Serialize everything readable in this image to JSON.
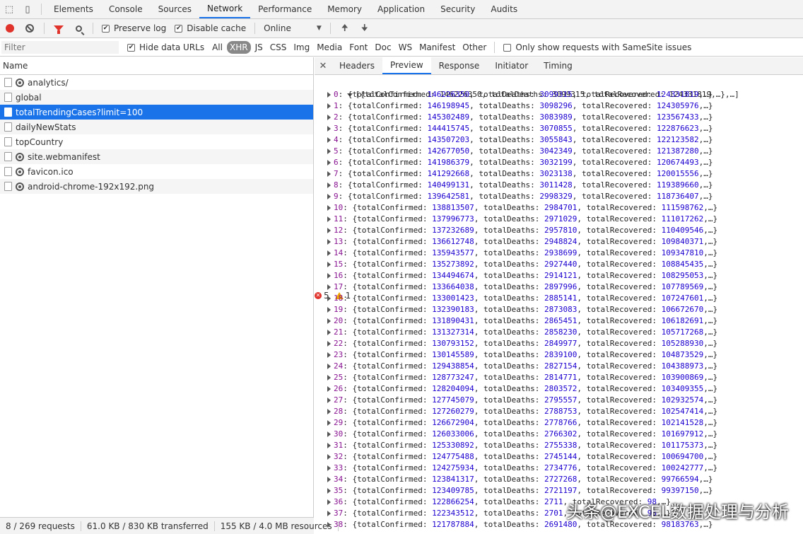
{
  "tabs": [
    "Elements",
    "Console",
    "Sources",
    "Network",
    "Performance",
    "Memory",
    "Application",
    "Security",
    "Audits"
  ],
  "active_tab": "Network",
  "errors_count": "5",
  "warnings_count": "1",
  "toolbar": {
    "preserve_log": "Preserve log",
    "disable_cache": "Disable cache",
    "throttle": "Online"
  },
  "filter": {
    "placeholder": "Filter",
    "hide_data_urls": "Hide data URLs",
    "types": [
      "All",
      "XHR",
      "JS",
      "CSS",
      "Img",
      "Media",
      "Font",
      "Doc",
      "WS",
      "Manifest",
      "Other"
    ],
    "active_type": "XHR",
    "samesite": "Only show requests with SameSite issues"
  },
  "list": {
    "header": "Name",
    "rows": [
      {
        "name": "analytics/",
        "gear": true
      },
      {
        "name": "global",
        "gear": false
      },
      {
        "name": "totalTrendingCases?limit=100",
        "gear": false,
        "selected": true
      },
      {
        "name": "dailyNewStats",
        "gear": false
      },
      {
        "name": "topCountry",
        "gear": false
      },
      {
        "name": "site.webmanifest",
        "gear": true
      },
      {
        "name": "favicon.ico",
        "gear": true
      },
      {
        "name": "android-chrome-192x192.png",
        "gear": true
      }
    ]
  },
  "status": {
    "requests": "8 / 269 requests",
    "transferred": "61.0 KB / 830 KB transferred",
    "resources": "155 KB / 4.0 MB resources"
  },
  "detail_tabs": [
    "Headers",
    "Preview",
    "Response",
    "Initiator",
    "Timing"
  ],
  "active_detail_tab": "Preview",
  "preview": {
    "root": "[{totalConfirmed: 146226350, totalDeaths: 3099315, totalRecovered: 124331819,…},…]",
    "items": [
      {
        "i": "0",
        "c": "146226350",
        "d": "3099315",
        "r": "124331819"
      },
      {
        "i": "1",
        "c": "146198945",
        "d": "3098296",
        "r": "124305976"
      },
      {
        "i": "2",
        "c": "145302489",
        "d": "3083989",
        "r": "123567433"
      },
      {
        "i": "3",
        "c": "144415745",
        "d": "3070855",
        "r": "122876623"
      },
      {
        "i": "4",
        "c": "143507203",
        "d": "3055843",
        "r": "122123582"
      },
      {
        "i": "5",
        "c": "142677050",
        "d": "3042349",
        "r": "121387280"
      },
      {
        "i": "6",
        "c": "141986379",
        "d": "3032199",
        "r": "120674493"
      },
      {
        "i": "7",
        "c": "141292668",
        "d": "3023138",
        "r": "120015556"
      },
      {
        "i": "8",
        "c": "140499131",
        "d": "3011428",
        "r": "119389660"
      },
      {
        "i": "9",
        "c": "139642581",
        "d": "2998329",
        "r": "118736407"
      },
      {
        "i": "10",
        "c": "138813507",
        "d": "2984701",
        "r": "111598762"
      },
      {
        "i": "11",
        "c": "137996773",
        "d": "2971029",
        "r": "111017262"
      },
      {
        "i": "12",
        "c": "137232689",
        "d": "2957810",
        "r": "110409546"
      },
      {
        "i": "13",
        "c": "136612748",
        "d": "2948824",
        "r": "109840371"
      },
      {
        "i": "14",
        "c": "135943577",
        "d": "2938699",
        "r": "109347810"
      },
      {
        "i": "15",
        "c": "135273892",
        "d": "2927440",
        "r": "108845435"
      },
      {
        "i": "16",
        "c": "134494674",
        "d": "2914121",
        "r": "108295053"
      },
      {
        "i": "17",
        "c": "133664038",
        "d": "2897996",
        "r": "107789569"
      },
      {
        "i": "18",
        "c": "133001423",
        "d": "2885141",
        "r": "107247601"
      },
      {
        "i": "19",
        "c": "132390183",
        "d": "2873083",
        "r": "106672670"
      },
      {
        "i": "20",
        "c": "131890431",
        "d": "2865451",
        "r": "106182691"
      },
      {
        "i": "21",
        "c": "131327314",
        "d": "2858230",
        "r": "105717268"
      },
      {
        "i": "22",
        "c": "130793152",
        "d": "2849977",
        "r": "105288930"
      },
      {
        "i": "23",
        "c": "130145589",
        "d": "2839100",
        "r": "104873529"
      },
      {
        "i": "24",
        "c": "129438854",
        "d": "2827154",
        "r": "104388973"
      },
      {
        "i": "25",
        "c": "128773247",
        "d": "2814771",
        "r": "103900869"
      },
      {
        "i": "26",
        "c": "128204094",
        "d": "2803572",
        "r": "103409355"
      },
      {
        "i": "27",
        "c": "127745079",
        "d": "2795557",
        "r": "102932574"
      },
      {
        "i": "28",
        "c": "127260279",
        "d": "2788753",
        "r": "102547414"
      },
      {
        "i": "29",
        "c": "126672904",
        "d": "2778766",
        "r": "102141528"
      },
      {
        "i": "30",
        "c": "126033006",
        "d": "2766302",
        "r": "101697912"
      },
      {
        "i": "31",
        "c": "125330892",
        "d": "2755338",
        "r": "101175373"
      },
      {
        "i": "32",
        "c": "124775488",
        "d": "2745144",
        "r": "100694700"
      },
      {
        "i": "33",
        "c": "124275934",
        "d": "2734776",
        "r": "100242777"
      },
      {
        "i": "34",
        "c": "123841317",
        "d": "2727268",
        "r": "99766594"
      },
      {
        "i": "35",
        "c": "123409785",
        "d": "2721197",
        "r": "99397150"
      },
      {
        "i": "36",
        "c": "122866254",
        "d": "2711",
        "r": "98"
      },
      {
        "i": "37",
        "c": "122343512",
        "d": "2701",
        "r": "98"
      },
      {
        "i": "38",
        "c": "121787884",
        "d": "2691480",
        "r": "98183763"
      }
    ]
  },
  "watermark": "头条@EXCEL数据处理与分析"
}
